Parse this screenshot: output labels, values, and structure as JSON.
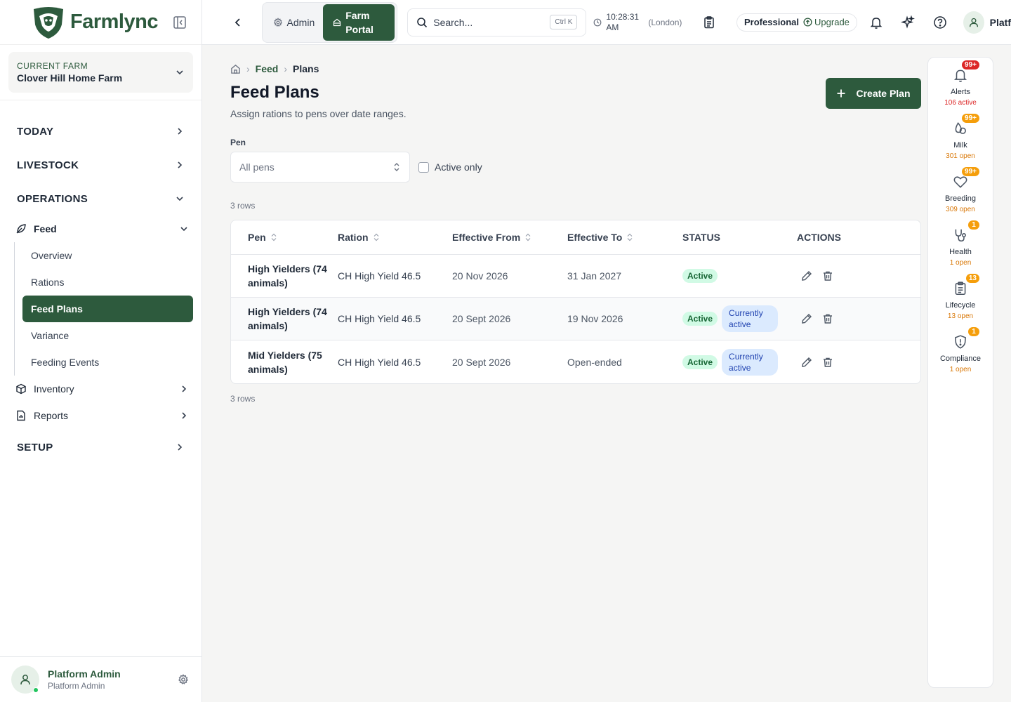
{
  "brand": {
    "name": "Farmlync",
    "color": "#2d5a3d"
  },
  "farm": {
    "label": "CURRENT FARM",
    "name": "Clover Hill Home Farm"
  },
  "nav": {
    "today": "TODAY",
    "livestock": "LIVESTOCK",
    "operations": "OPERATIONS",
    "feed": "Feed",
    "feed_items": [
      "Overview",
      "Rations",
      "Feed Plans",
      "Variance",
      "Feeding Events"
    ],
    "inventory": "Inventory",
    "reports": "Reports",
    "setup": "SETUP"
  },
  "user": {
    "name": "Platform Admin",
    "role": "Platform Admin"
  },
  "topbar": {
    "admin_label": "Admin",
    "farm_portal_line1": "Farm",
    "farm_portal_line2": "Portal",
    "search_placeholder": "Search...",
    "search_shortcut": "Ctrl K",
    "time_line1": "10:28:31",
    "time_line2": "AM",
    "timezone": "(London)",
    "plan_tier": "Professional",
    "upgrade_label": "Upgrade",
    "user_short": "Platf"
  },
  "breadcrumb": {
    "feed": "Feed",
    "current": "Plans"
  },
  "page": {
    "title": "Feed Plans",
    "subtitle": "Assign rations to pens over date ranges.",
    "create_label": "Create Plan"
  },
  "filters": {
    "pen_label": "Pen",
    "pen_value": "All pens",
    "active_only": "Active only"
  },
  "table": {
    "rows_count": "3 rows",
    "headers": {
      "pen": "Pen",
      "ration": "Ration",
      "from": "Effective From",
      "to": "Effective To",
      "status": "STATUS",
      "actions": "ACTIONS"
    },
    "rows": [
      {
        "pen_line1": "High Yielders (74",
        "pen_line2": "animals)",
        "ration": "CH High Yield 46.5",
        "from": "20 Nov 2026",
        "to": "31 Jan 2027",
        "status": "Active"
      },
      {
        "pen_line1": "High Yielders (74",
        "pen_line2": "animals)",
        "ration": "CH High Yield 46.5",
        "from": "20 Sept 2026",
        "to": "19 Nov 2026",
        "status": "Active",
        "current_line1": "Currently",
        "current_line2": "active"
      },
      {
        "pen_line1": "Mid Yielders (75",
        "pen_line2": "animals)",
        "ration": "CH High Yield 46.5",
        "from": "20 Sept 2026",
        "to": "Open-ended",
        "status": "Active",
        "current_line1": "Currently",
        "current_line2": "active"
      }
    ]
  },
  "rail": [
    {
      "label": "Alerts",
      "badge": "99+",
      "count": "106 active",
      "icon": "bell-icon"
    },
    {
      "label": "Milk",
      "badge": "99+",
      "count": "301 open",
      "icon": "milk-drop-icon"
    },
    {
      "label": "Breeding",
      "badge": "99+",
      "count": "309 open",
      "icon": "heart-icon"
    },
    {
      "label": "Health",
      "badge": "1",
      "count": "1 open",
      "icon": "stethoscope-icon"
    },
    {
      "label": "Lifecycle",
      "badge": "13",
      "count": "13 open",
      "icon": "clipboard-icon"
    },
    {
      "label": "Compliance",
      "badge": "1",
      "count": "1 open",
      "icon": "shield-alert-icon"
    }
  ]
}
